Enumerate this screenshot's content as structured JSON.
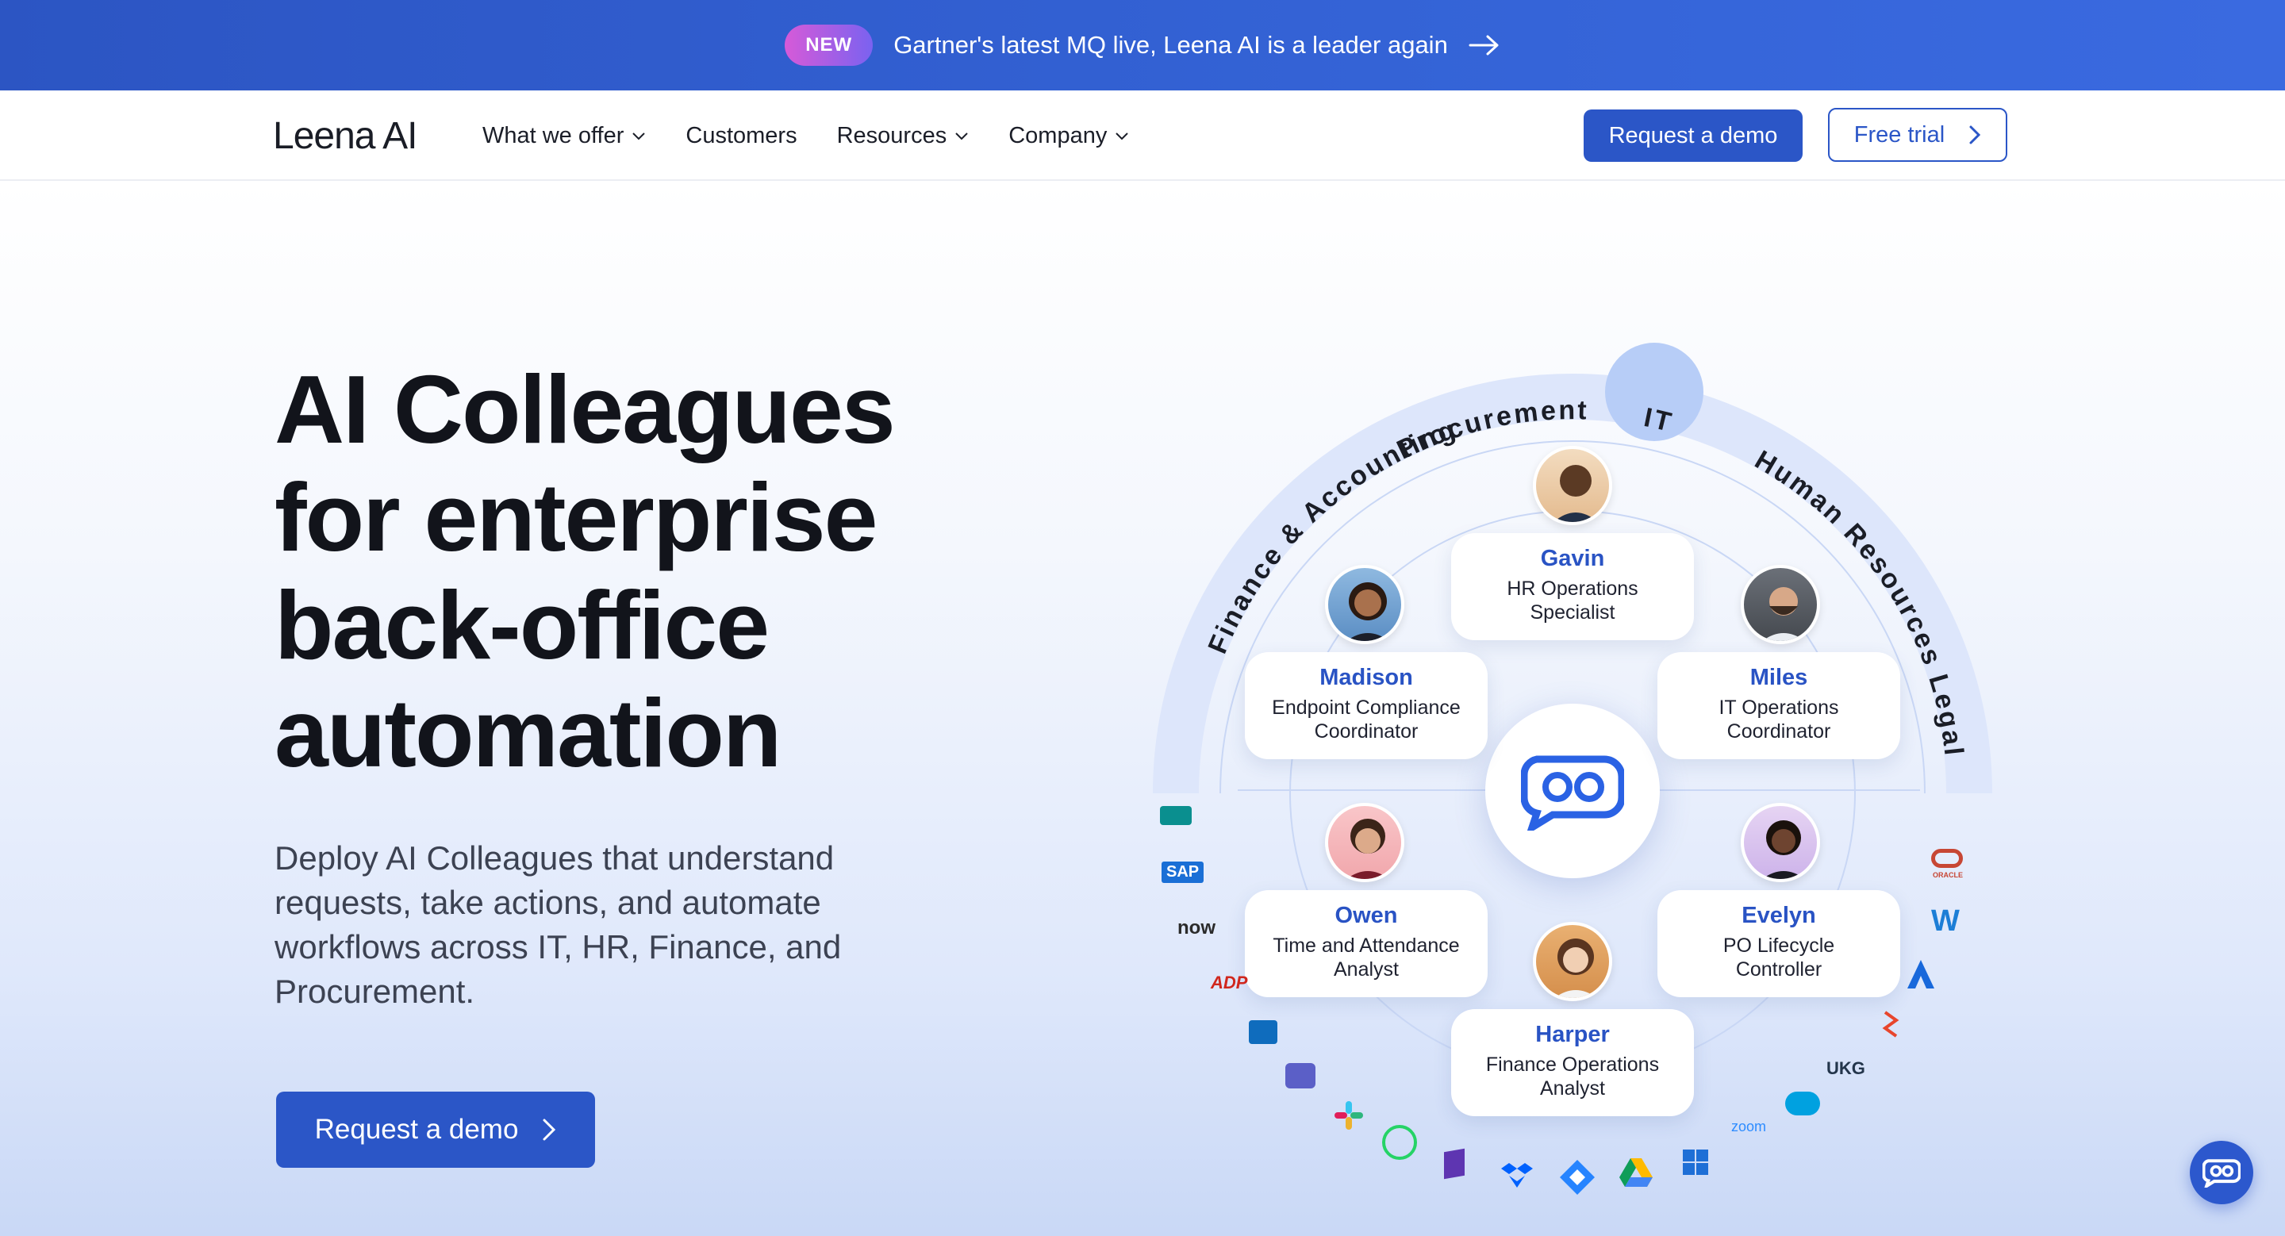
{
  "announcement": {
    "badge": "NEW",
    "message": "Gartner's latest MQ live, Leena AI is a leader again"
  },
  "nav": {
    "logo": "Leena AI",
    "items": [
      {
        "label": "What we offer",
        "has_dropdown": true
      },
      {
        "label": "Customers",
        "has_dropdown": false
      },
      {
        "label": "Resources",
        "has_dropdown": true
      },
      {
        "label": "Company",
        "has_dropdown": true
      }
    ],
    "request_demo": "Request a demo",
    "free_trial": "Free trial"
  },
  "hero": {
    "headline_lines": [
      "AI Colleagues",
      "for enterprise",
      "back-office",
      "automation"
    ],
    "subtext_lines": [
      "Deploy AI Colleagues that understand",
      "requests, take actions, and automate",
      "workflows across IT, HR, Finance, and",
      "Procurement."
    ],
    "cta": "Request a demo"
  },
  "diagram": {
    "departments": [
      "Finance & Accounting",
      "Procurement",
      "IT",
      "Human Resources",
      "Legal"
    ],
    "colleagues": [
      {
        "name": "Gavin",
        "role_lines": [
          "HR Operations",
          "Specialist"
        ]
      },
      {
        "name": "Madison",
        "role_lines": [
          "Endpoint Compliance",
          "Coordinator"
        ]
      },
      {
        "name": "Miles",
        "role_lines": [
          "IT Operations",
          "Coordinator"
        ]
      },
      {
        "name": "Owen",
        "role_lines": [
          "Time and Attendance",
          "Analyst"
        ]
      },
      {
        "name": "Evelyn",
        "role_lines": [
          "PO Lifecycle",
          "Controller"
        ]
      },
      {
        "name": "Harper",
        "role_lines": [
          "Finance Operations",
          "Analyst"
        ]
      }
    ],
    "integrations": [
      "SAP",
      "now",
      "ADP",
      "UKG",
      "zoom",
      "ORACLE"
    ]
  },
  "colors": {
    "brand_blue": "#2b56c7",
    "announce_bg": "#3463d6",
    "name_blue": "#2953c4"
  }
}
